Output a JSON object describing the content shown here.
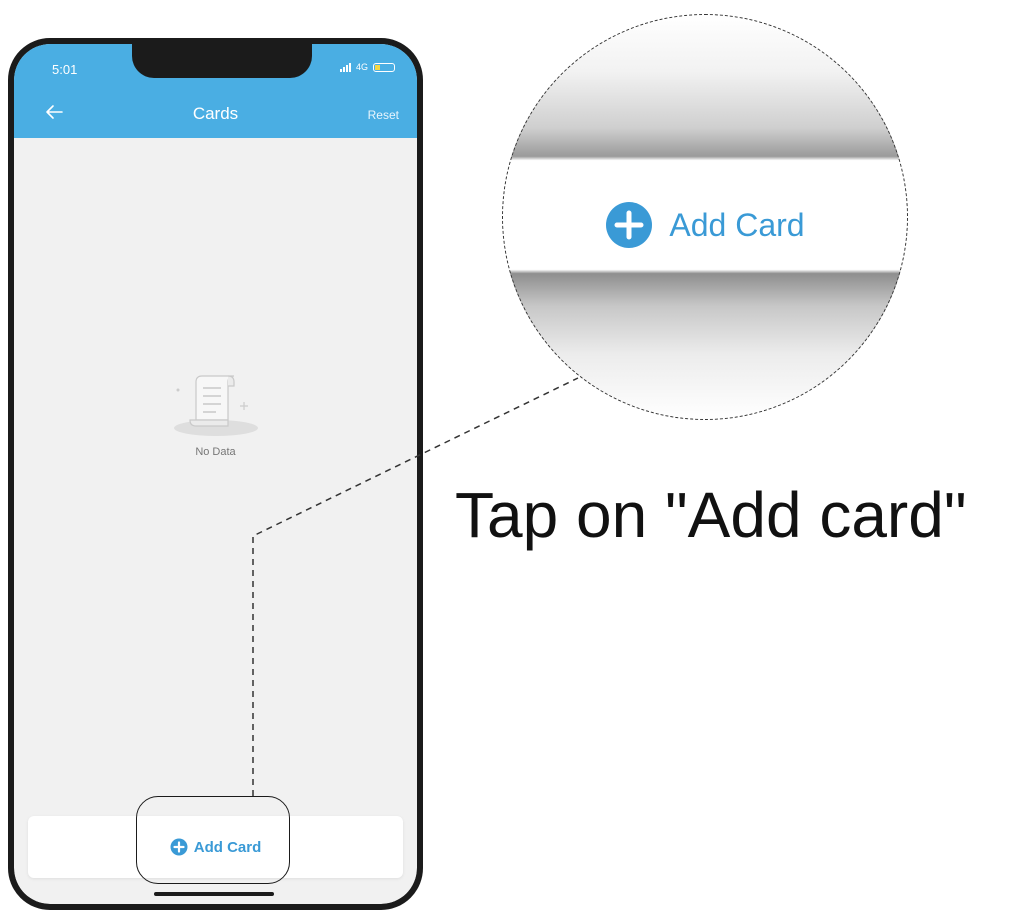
{
  "status_bar": {
    "time": "5:01",
    "network": "4G"
  },
  "nav": {
    "title": "Cards",
    "reset_label": "Reset"
  },
  "empty_state": {
    "label": "No Data"
  },
  "bottom": {
    "add_card_label": "Add Card"
  },
  "magnifier": {
    "add_card_label": "Add Card"
  },
  "instruction": {
    "text": "Tap on \"Add card\""
  },
  "colors": {
    "accent": "#4aaee3",
    "link": "#3a9ad6",
    "background": "#f1f1f1"
  }
}
